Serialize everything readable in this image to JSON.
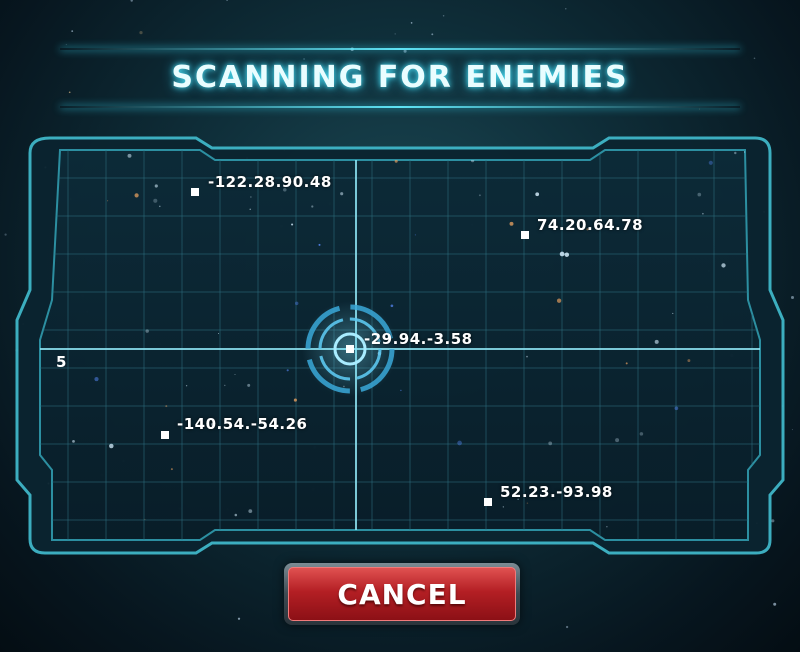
{
  "header": {
    "title": "SCANNING FOR ENEMIES"
  },
  "radar": {
    "edge_label": "5",
    "targets": [
      {
        "label": "-122.28.90.48"
      },
      {
        "label": "74.20.64.78"
      },
      {
        "label": "-29.94.-3.58"
      },
      {
        "label": "-140.54.-54.26"
      },
      {
        "label": "52.23.-93.98"
      }
    ]
  },
  "buttons": {
    "cancel_label": "CANCEL"
  },
  "colors": {
    "accent_cyan": "#5fe3f5",
    "frame": "#3fb6c8",
    "cancel_red": "#b41f24",
    "text": "#ffffff"
  }
}
